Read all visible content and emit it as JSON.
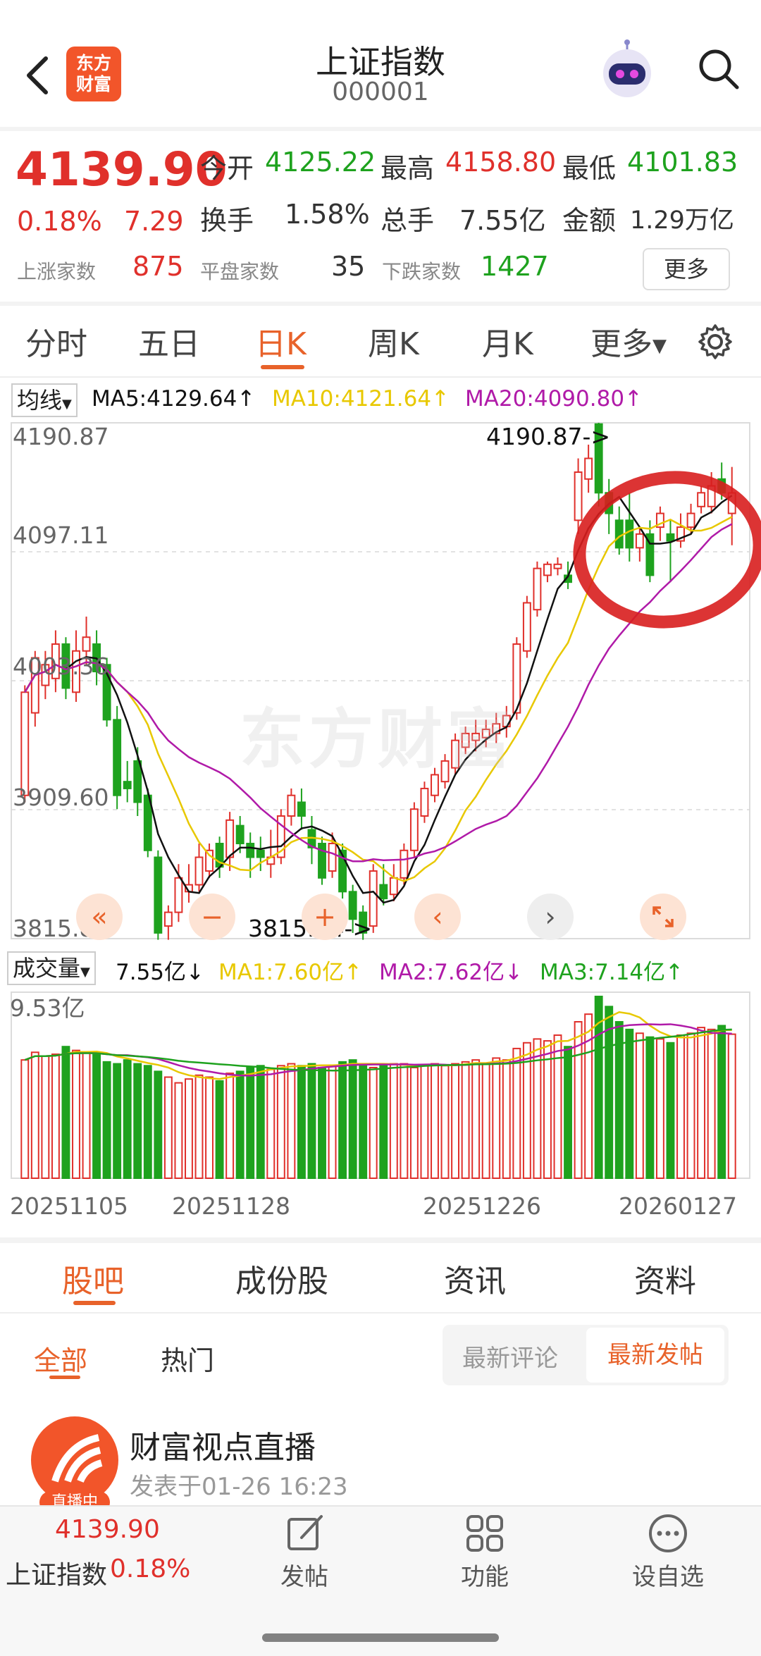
{
  "header": {
    "logo_line1": "东方",
    "logo_line2": "财富",
    "title": "上证指数",
    "code": "000001"
  },
  "quote": {
    "price": "4139.90",
    "change_pct": "0.18%",
    "change": "7.29",
    "open_label": "今开",
    "open": "4125.22",
    "high_label": "最高",
    "high": "4158.80",
    "low_label": "最低",
    "low": "4101.83",
    "turnover_label": "换手",
    "turnover": "1.58%",
    "volume_label": "总手",
    "volume": "7.55亿",
    "amount_label": "金额",
    "amount": "1.29万亿",
    "up_label": "上涨家数",
    "up": "875",
    "flat_label": "平盘家数",
    "flat": "35",
    "down_label": "下跌家数",
    "down": "1427",
    "more_label": "更多"
  },
  "period_tabs": [
    "分时",
    "五日",
    "日K",
    "周K",
    "月K",
    "更多"
  ],
  "active_tab_index": 2,
  "ma_bar": {
    "dropdown": "均线",
    "ma5": "MA5:4129.64↑",
    "ma10": "MA10:4121.64↑",
    "ma20": "MA20:4090.80↑"
  },
  "price_axis": [
    "4190.87",
    "4097.11",
    "4003.36",
    "3909.60",
    "3815.84"
  ],
  "annotations": {
    "high_mark": "4190.87->",
    "low_mark": "3815.84->"
  },
  "watermark": "东方财富",
  "volume_bar": {
    "dropdown": "成交量",
    "vol": "7.55亿↓",
    "ma1": "MA1:7.60亿↑",
    "ma2": "MA2:7.62亿↓",
    "ma3": "MA3:7.14亿↑",
    "max_label": "9.53亿"
  },
  "date_axis": [
    "20251105",
    "20251128",
    "20251226",
    "20260127"
  ],
  "section_tabs": [
    "股吧",
    "成份股",
    "资讯",
    "资料"
  ],
  "filter": {
    "all": "全部",
    "hot": "热门",
    "latest_comment": "最新评论",
    "latest_post": "最新发帖"
  },
  "post": {
    "avatar_badge": "直播中",
    "title": "财富视点直播",
    "time": "发表于01-26 16:23"
  },
  "bottom_bar": {
    "price": "4139.90",
    "name": "上证指数",
    "pct": "0.18%",
    "post": "发帖",
    "function": "功能",
    "watchlist": "设自选"
  },
  "colors": {
    "up": "#e0302b",
    "down": "#1ea21e",
    "accent": "#e8622a",
    "ma5": "#111111",
    "ma10": "#e8c800",
    "ma20": "#b01aa8"
  },
  "chart_data": {
    "type": "candlestick",
    "ylim": [
      3815.84,
      4190.87
    ],
    "candles": [
      {
        "o": 3920,
        "c": 3995,
        "h": 4000,
        "l": 3915
      },
      {
        "o": 3980,
        "c": 4020,
        "h": 4025,
        "l": 3970
      },
      {
        "o": 4000,
        "c": 4015,
        "h": 4025,
        "l": 3990
      },
      {
        "o": 4005,
        "c": 4030,
        "h": 4040,
        "l": 3995
      },
      {
        "o": 4030,
        "c": 3998,
        "h": 4035,
        "l": 3990
      },
      {
        "o": 3995,
        "c": 4025,
        "h": 4040,
        "l": 3988
      },
      {
        "o": 4025,
        "c": 4035,
        "h": 4050,
        "l": 4015
      },
      {
        "o": 4030,
        "c": 4010,
        "h": 4040,
        "l": 4000
      },
      {
        "o": 4015,
        "c": 3975,
        "h": 4020,
        "l": 3970
      },
      {
        "o": 3975,
        "c": 3920,
        "h": 3985,
        "l": 3910
      },
      {
        "o": 3930,
        "c": 3925,
        "h": 3945,
        "l": 3915
      },
      {
        "o": 3945,
        "c": 3915,
        "h": 3955,
        "l": 3905
      },
      {
        "o": 3920,
        "c": 3880,
        "h": 3925,
        "l": 3875
      },
      {
        "o": 3875,
        "c": 3820,
        "h": 3880,
        "l": 3815
      },
      {
        "o": 3825,
        "c": 3835,
        "h": 3840,
        "l": 3815
      },
      {
        "o": 3835,
        "c": 3860,
        "h": 3870,
        "l": 3828
      },
      {
        "o": 3850,
        "c": 3855,
        "h": 3870,
        "l": 3842
      },
      {
        "o": 3855,
        "c": 3875,
        "h": 3885,
        "l": 3850
      },
      {
        "o": 3865,
        "c": 3880,
        "h": 3885,
        "l": 3860
      },
      {
        "o": 3885,
        "c": 3868,
        "h": 3890,
        "l": 3860
      },
      {
        "o": 3875,
        "c": 3902,
        "h": 3908,
        "l": 3865
      },
      {
        "o": 3898,
        "c": 3885,
        "h": 3905,
        "l": 3878
      },
      {
        "o": 3885,
        "c": 3875,
        "h": 3893,
        "l": 3860
      },
      {
        "o": 3880,
        "c": 3875,
        "h": 3890,
        "l": 3865
      },
      {
        "o": 3870,
        "c": 3875,
        "h": 3895,
        "l": 3860
      },
      {
        "o": 3875,
        "c": 3905,
        "h": 3910,
        "l": 3870
      },
      {
        "o": 3905,
        "c": 3920,
        "h": 3925,
        "l": 3898
      },
      {
        "o": 3915,
        "c": 3905,
        "h": 3925,
        "l": 3895
      },
      {
        "o": 3895,
        "c": 3882,
        "h": 3905,
        "l": 3870
      },
      {
        "o": 3885,
        "c": 3860,
        "h": 3890,
        "l": 3855
      },
      {
        "o": 3865,
        "c": 3885,
        "h": 3893,
        "l": 3860
      },
      {
        "o": 3880,
        "c": 3850,
        "h": 3885,
        "l": 3845
      },
      {
        "o": 3850,
        "c": 3830,
        "h": 3855,
        "l": 3820
      },
      {
        "o": 3835,
        "c": 3820,
        "h": 3840,
        "l": 3815
      },
      {
        "o": 3825,
        "c": 3865,
        "h": 3870,
        "l": 3820
      },
      {
        "o": 3855,
        "c": 3845,
        "h": 3870,
        "l": 3840
      },
      {
        "o": 3848,
        "c": 3860,
        "h": 3870,
        "l": 3843
      },
      {
        "o": 3860,
        "c": 3880,
        "h": 3885,
        "l": 3855
      },
      {
        "o": 3880,
        "c": 3910,
        "h": 3915,
        "l": 3875
      },
      {
        "o": 3905,
        "c": 3925,
        "h": 3930,
        "l": 3900
      },
      {
        "o": 3920,
        "c": 3935,
        "h": 3940,
        "l": 3915
      },
      {
        "o": 3930,
        "c": 3945,
        "h": 3950,
        "l": 3925
      },
      {
        "o": 3940,
        "c": 3960,
        "h": 3965,
        "l": 3935
      },
      {
        "o": 3955,
        "c": 3965,
        "h": 3970,
        "l": 3950
      },
      {
        "o": 3960,
        "c": 3965,
        "h": 3975,
        "l": 3952
      },
      {
        "o": 3962,
        "c": 3968,
        "h": 3975,
        "l": 3955
      },
      {
        "o": 3965,
        "c": 3972,
        "h": 3980,
        "l": 3958
      },
      {
        "o": 3970,
        "c": 3978,
        "h": 3985,
        "l": 3962
      },
      {
        "o": 3980,
        "c": 4030,
        "h": 4035,
        "l": 3975
      },
      {
        "o": 4025,
        "c": 4060,
        "h": 4065,
        "l": 4020
      },
      {
        "o": 4055,
        "c": 4085,
        "h": 4090,
        "l": 4050
      },
      {
        "o": 4080,
        "c": 4088,
        "h": 4090,
        "l": 4075
      },
      {
        "o": 4085,
        "c": 4088,
        "h": 4093,
        "l": 4080
      },
      {
        "o": 4080,
        "c": 4075,
        "h": 4090,
        "l": 4070
      },
      {
        "o": 4120,
        "c": 4155,
        "h": 4165,
        "l": 4110
      },
      {
        "o": 4150,
        "c": 4165,
        "h": 4175,
        "l": 4140
      },
      {
        "o": 4190,
        "c": 4140,
        "h": 4190.87,
        "l": 4130
      },
      {
        "o": 4140,
        "c": 4125,
        "h": 4150,
        "l": 4110
      },
      {
        "o": 4120,
        "c": 4100,
        "h": 4130,
        "l": 4095
      },
      {
        "o": 4120,
        "c": 4100,
        "h": 4140,
        "l": 4090
      },
      {
        "o": 4100,
        "c": 4110,
        "h": 4115,
        "l": 4090
      },
      {
        "o": 4110,
        "c": 4080,
        "h": 4120,
        "l": 4075
      },
      {
        "o": 4115,
        "c": 4125,
        "h": 4130,
        "l": 4105
      },
      {
        "o": 4110,
        "c": 4105,
        "h": 4120,
        "l": 4075
      },
      {
        "o": 4105,
        "c": 4115,
        "h": 4125,
        "l": 4100
      },
      {
        "o": 4115,
        "c": 4125,
        "h": 4132,
        "l": 4110
      },
      {
        "o": 4130,
        "c": 4140,
        "h": 4145,
        "l": 4125
      },
      {
        "o": 4130,
        "c": 4145,
        "h": 4155,
        "l": 4125
      },
      {
        "o": 4150,
        "c": 4140,
        "h": 4162,
        "l": 4135
      },
      {
        "o": 4125,
        "c": 4139.9,
        "h": 4158.8,
        "l": 4101.83
      }
    ],
    "volume": [
      6.2,
      6.6,
      6.4,
      6.5,
      6.9,
      6.7,
      6.6,
      6.5,
      6.1,
      6.0,
      6.2,
      6.0,
      5.9,
      5.6,
      5.3,
      5.0,
      5.2,
      5.4,
      5.3,
      5.1,
      5.5,
      5.6,
      5.8,
      5.9,
      5.7,
      5.9,
      6.0,
      5.9,
      6.0,
      5.8,
      5.9,
      6.1,
      6.2,
      6.0,
      5.8,
      5.9,
      6.0,
      6.0,
      5.8,
      5.9,
      6.0,
      5.9,
      6.0,
      6.1,
      6.2,
      6.0,
      6.3,
      6.2,
      6.8,
      7.1,
      7.3,
      7.2,
      7.5,
      6.9,
      8.2,
      8.6,
      9.53,
      9.0,
      8.2,
      7.8,
      7.6,
      7.4,
      7.3,
      7.1,
      7.5,
      7.6,
      7.9,
      7.8,
      8.0,
      7.55
    ]
  }
}
